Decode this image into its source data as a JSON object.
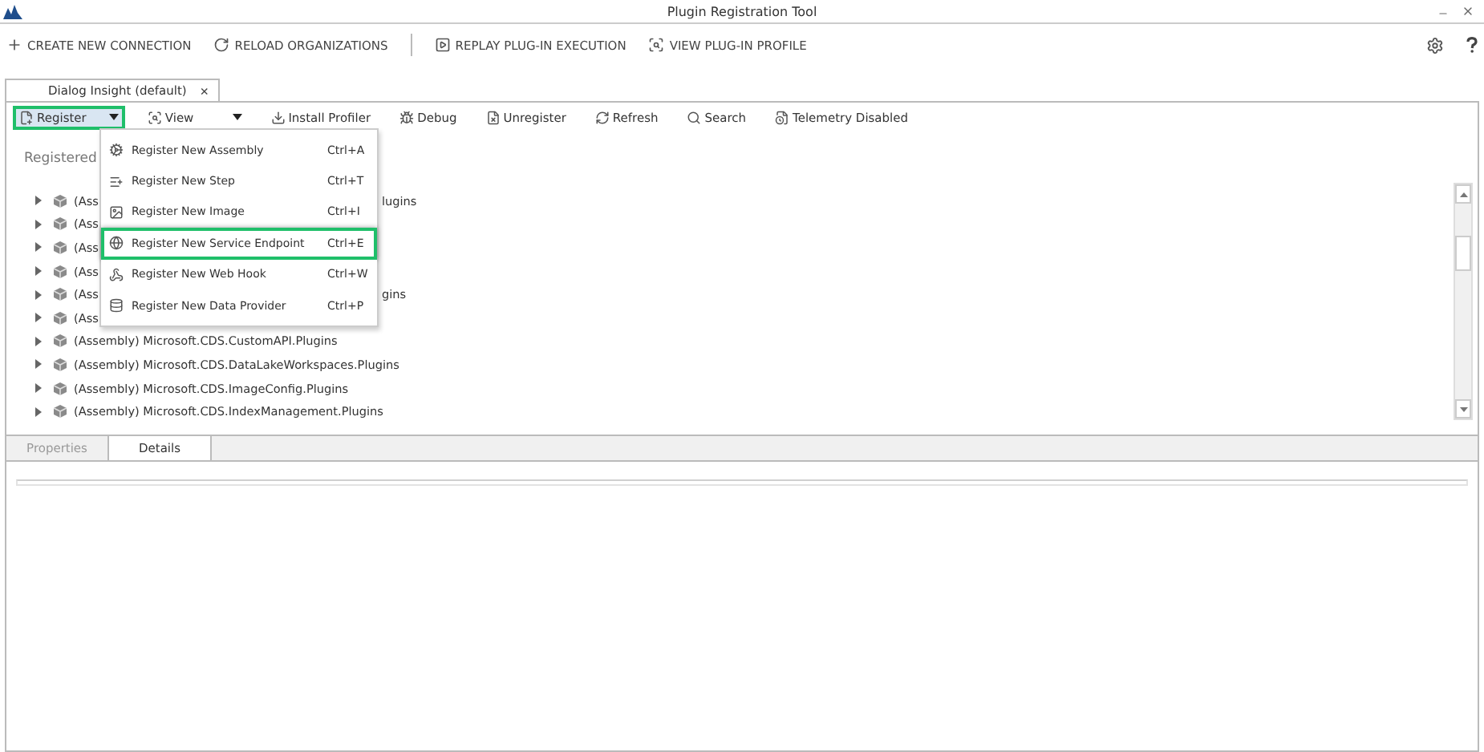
{
  "window": {
    "title": "Plugin Registration Tool"
  },
  "top_toolbar": [
    {
      "label": "CREATE NEW CONNECTION",
      "kind": "plus"
    },
    {
      "label": "RELOAD ORGANIZATIONS",
      "kind": "reload"
    },
    {
      "label": "REPLAY PLUG-IN EXECUTION",
      "kind": "play"
    },
    {
      "label": "VIEW PLUG-IN PROFILE",
      "kind": "profile"
    }
  ],
  "connection_tab": {
    "label": "Dialog Insight (default)",
    "close": "×"
  },
  "toolbar": [
    {
      "label": "Register",
      "kind": "register",
      "dropdown": true,
      "highlighted": true
    },
    {
      "label": "View",
      "kind": "view",
      "dropdown": true,
      "highlighted": false
    },
    {
      "label": "Install Profiler",
      "kind": "install",
      "dropdown": false,
      "highlighted": false
    },
    {
      "label": "Debug",
      "kind": "debug",
      "dropdown": false,
      "highlighted": false
    },
    {
      "label": "Unregister",
      "kind": "unregister",
      "dropdown": false,
      "highlighted": false
    },
    {
      "label": "Refresh",
      "kind": "refresh",
      "dropdown": false,
      "highlighted": false
    },
    {
      "label": "Search",
      "kind": "search",
      "dropdown": false,
      "highlighted": false
    },
    {
      "label": "Telemetry Disabled",
      "kind": "telemetry",
      "dropdown": false,
      "highlighted": false
    }
  ],
  "register_menu": [
    {
      "label": "Register New Assembly",
      "shortcut": "Ctrl+A",
      "kind": "assembly",
      "highlighted": false
    },
    {
      "label": "Register New Step",
      "shortcut": "Ctrl+T",
      "kind": "step",
      "highlighted": false
    },
    {
      "label": "Register New Image",
      "shortcut": "Ctrl+I",
      "kind": "image",
      "highlighted": false
    },
    {
      "label": "Register New Service Endpoint",
      "shortcut": "Ctrl+E",
      "kind": "endpoint",
      "highlighted": true
    },
    {
      "label": "Register New Web Hook",
      "shortcut": "Ctrl+W",
      "kind": "webhook",
      "highlighted": false
    },
    {
      "label": "Register New Data Provider",
      "shortcut": "Ctrl+P",
      "kind": "provider",
      "highlighted": false
    }
  ],
  "tree_heading": "Registered",
  "tree": [
    {
      "label": "(Ass",
      "tail": "lugins"
    },
    {
      "label": "(Ass"
    },
    {
      "label": "(Ass"
    },
    {
      "label": "(Ass"
    },
    {
      "label": "(Ass",
      "tail": "gins"
    },
    {
      "label": "(Ass"
    },
    {
      "label": "(Assembly) Microsoft.CDS.CustomAPI.Plugins"
    },
    {
      "label": "(Assembly) Microsoft.CDS.DataLakeWorkspaces.Plugins"
    },
    {
      "label": "(Assembly) Microsoft.CDS.ImageConfig.Plugins"
    },
    {
      "label": "(Assembly) Microsoft.CDS.IndexManagement.Plugins"
    }
  ],
  "bottom_tabs": [
    {
      "label": "Properties",
      "selected": false
    },
    {
      "label": "Details",
      "selected": true
    }
  ]
}
